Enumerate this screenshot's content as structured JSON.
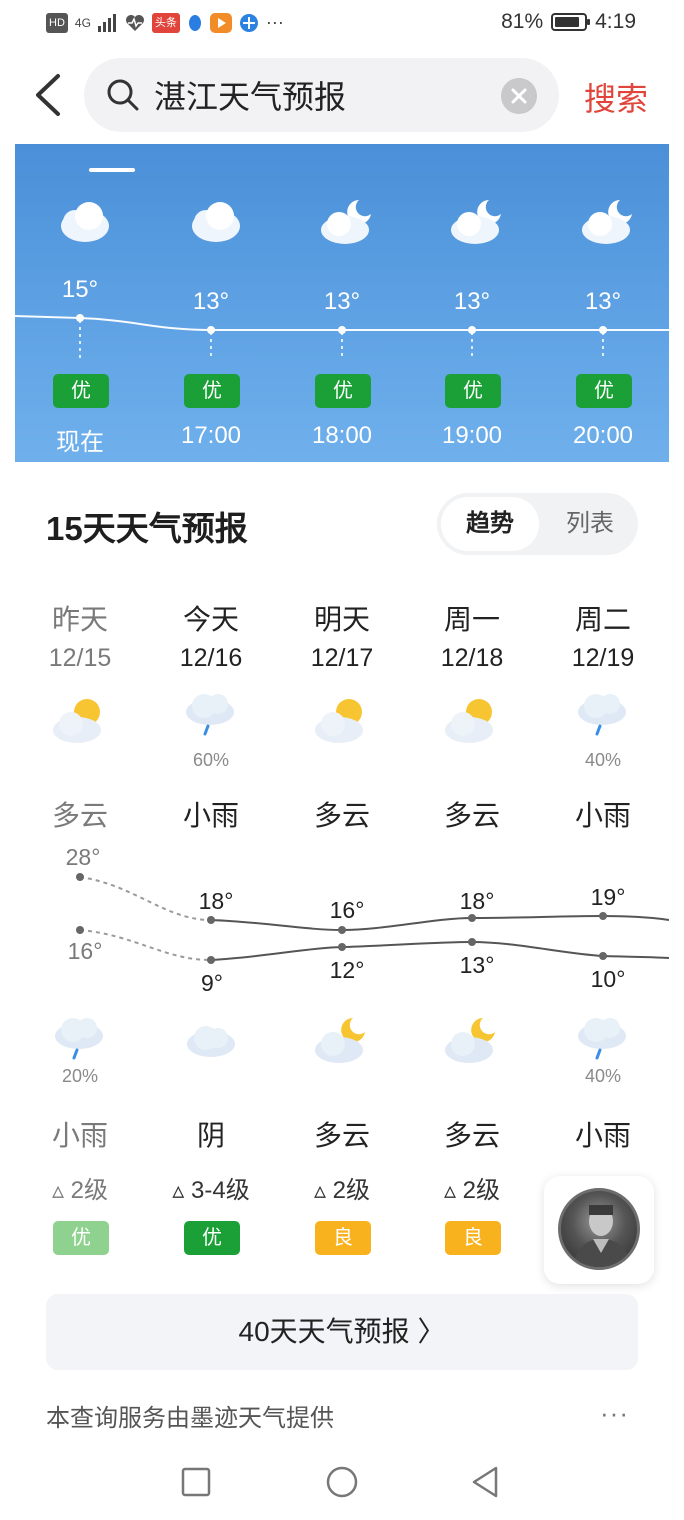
{
  "status_bar": {
    "network": "HD",
    "signal": "4G",
    "app_badge": "头条",
    "battery": "81%",
    "time": "4:19",
    "more": "···"
  },
  "search": {
    "query": "湛江天气预报",
    "button_label": "搜索"
  },
  "hourly": {
    "items": [
      {
        "temp": "15°",
        "aqi": "优",
        "time": "现在",
        "icon": "cloud-icon"
      },
      {
        "temp": "13°",
        "aqi": "优",
        "time": "17:00",
        "icon": "cloud-icon"
      },
      {
        "temp": "13°",
        "aqi": "优",
        "time": "18:00",
        "icon": "cloud-moon-icon"
      },
      {
        "temp": "13°",
        "aqi": "优",
        "time": "19:00",
        "icon": "cloud-moon-icon"
      },
      {
        "temp": "13°",
        "aqi": "优",
        "time": "20:00",
        "icon": "cloud-moon-icon"
      }
    ]
  },
  "forecast": {
    "title": "15天天气预报",
    "toggle_trend": "趋势",
    "toggle_list": "列表",
    "days": [
      {
        "name": "昨天",
        "date": "12/15",
        "day_icon": "partly-cloudy-icon",
        "day_pop": "",
        "day_cond": "多云",
        "high": "28°",
        "low": "16°",
        "night_icon": "cloud-rain-icon",
        "night_pop": "20%",
        "night_cond": "小雨",
        "wind": "2级",
        "aqi": "优",
        "aqi_color": "#8fd18f"
      },
      {
        "name": "今天",
        "date": "12/16",
        "day_icon": "cloud-rain-icon",
        "day_pop": "60%",
        "day_cond": "小雨",
        "high": "18°",
        "low": "9°",
        "night_icon": "overcast-icon",
        "night_pop": "",
        "night_cond": "阴",
        "wind": "3-4级",
        "aqi": "优",
        "aqi_color": "#1aa036"
      },
      {
        "name": "明天",
        "date": "12/17",
        "day_icon": "partly-cloudy-icon",
        "day_pop": "",
        "day_cond": "多云",
        "high": "16°",
        "low": "12°",
        "night_icon": "cloud-moon-icon",
        "night_pop": "",
        "night_cond": "多云",
        "wind": "2级",
        "aqi": "良",
        "aqi_color": "#f8b21d"
      },
      {
        "name": "周一",
        "date": "12/18",
        "day_icon": "partly-cloudy-icon",
        "day_pop": "",
        "day_cond": "多云",
        "high": "18°",
        "low": "13°",
        "night_icon": "cloud-moon-icon",
        "night_pop": "",
        "night_cond": "多云",
        "wind": "2级",
        "aqi": "良",
        "aqi_color": "#f8b21d"
      },
      {
        "name": "周二",
        "date": "12/19",
        "day_icon": "cloud-rain-icon",
        "day_pop": "40%",
        "day_cond": "小雨",
        "high": "19°",
        "low": "10°",
        "night_icon": "cloud-rain-icon",
        "night_pop": "40%",
        "night_cond": "小雨",
        "wind": "",
        "aqi": "",
        "aqi_color": "#f8b21d"
      }
    ],
    "forty_day_label": "40天天气预报 〉",
    "provider": "本查询服务由墨迹天气提供",
    "more": "···"
  },
  "colors": {
    "accent_red": "#e0443a",
    "aqi_good": "#1aa036",
    "aqi_moderate": "#f8b21d",
    "sky_top": "#4a8fd8"
  }
}
